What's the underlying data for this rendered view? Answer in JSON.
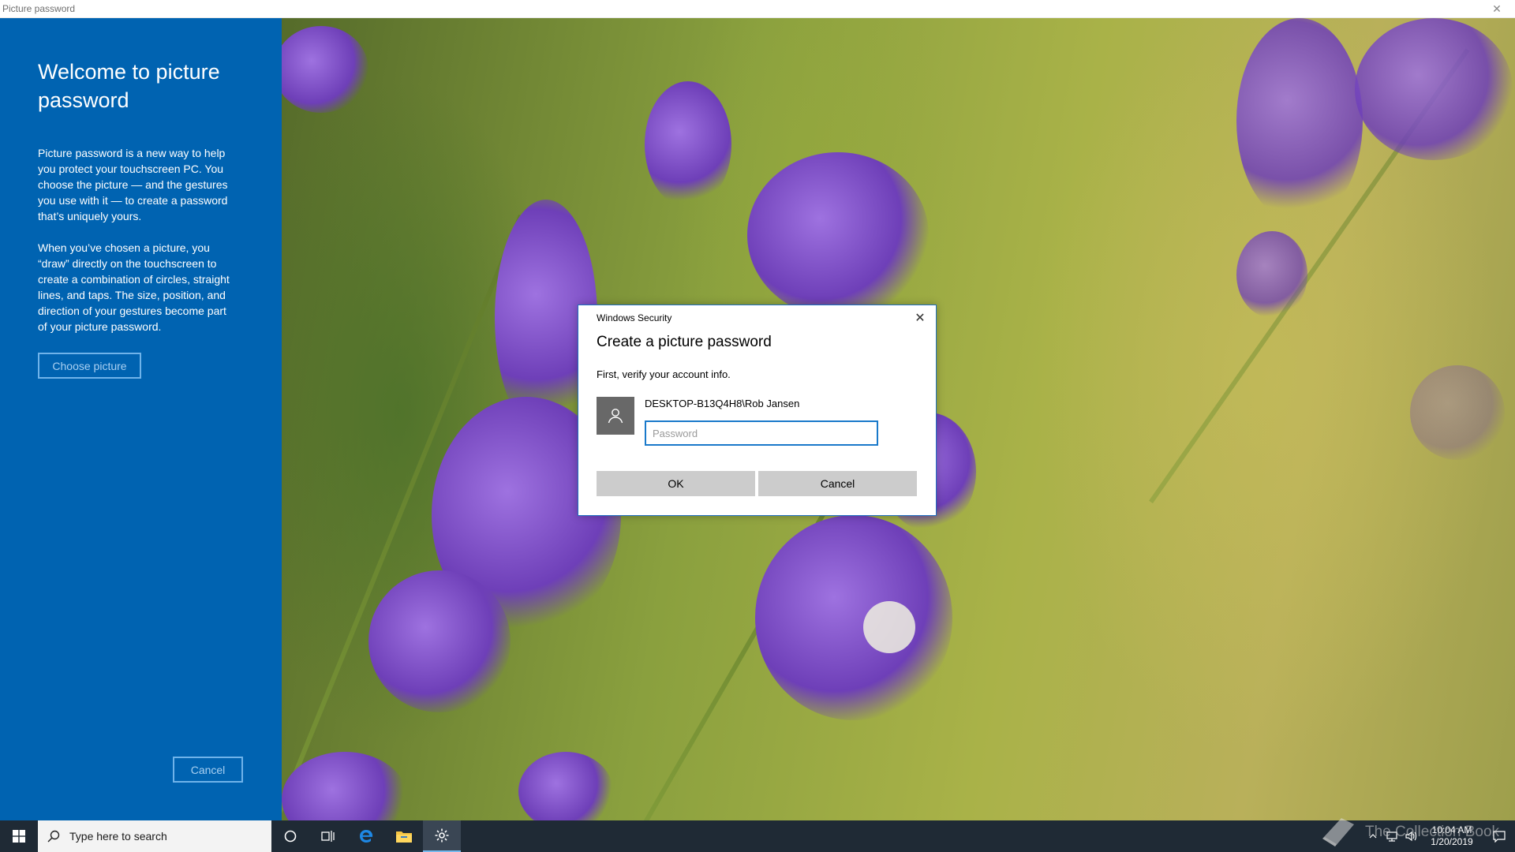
{
  "window": {
    "title": "Picture password",
    "close_glyph": "✕"
  },
  "left_pane": {
    "heading": "Welcome to picture password",
    "paragraph1": "Picture password is a new way to help you protect your touchscreen PC. You choose the picture — and the gestures you use with it — to create a password that’s uniquely yours.",
    "paragraph2": "When you’ve chosen a picture, you “draw” directly on the touchscreen to create a combination of circles, straight lines, and taps. The size, position, and direction of your gestures become part of your picture password.",
    "choose_button": "Choose picture",
    "cancel_button": "Cancel",
    "background_color": "#0063b1"
  },
  "dialog": {
    "title": "Windows Security",
    "heading": "Create a picture password",
    "subtitle": "First, verify your account info.",
    "account_name": "DESKTOP-B13Q4H8\\Rob Jansen",
    "password_value": "",
    "password_placeholder": "Password",
    "ok_label": "OK",
    "cancel_label": "Cancel",
    "close_glyph": "✕",
    "avatar_icon": "user-icon"
  },
  "taskbar": {
    "search_placeholder": "Type here to search",
    "pinned": [
      "cortana-icon",
      "task-view-icon",
      "edge-icon",
      "file-explorer-icon",
      "settings-icon"
    ],
    "active_app": "settings-icon",
    "clock_time": "10:04 AM",
    "clock_date": "1/20/2019",
    "tray_icons": [
      "chevron-up-icon",
      "network-icon",
      "volume-icon",
      "action-center-icon"
    ]
  },
  "watermark": {
    "text": "The Collection Book"
  }
}
